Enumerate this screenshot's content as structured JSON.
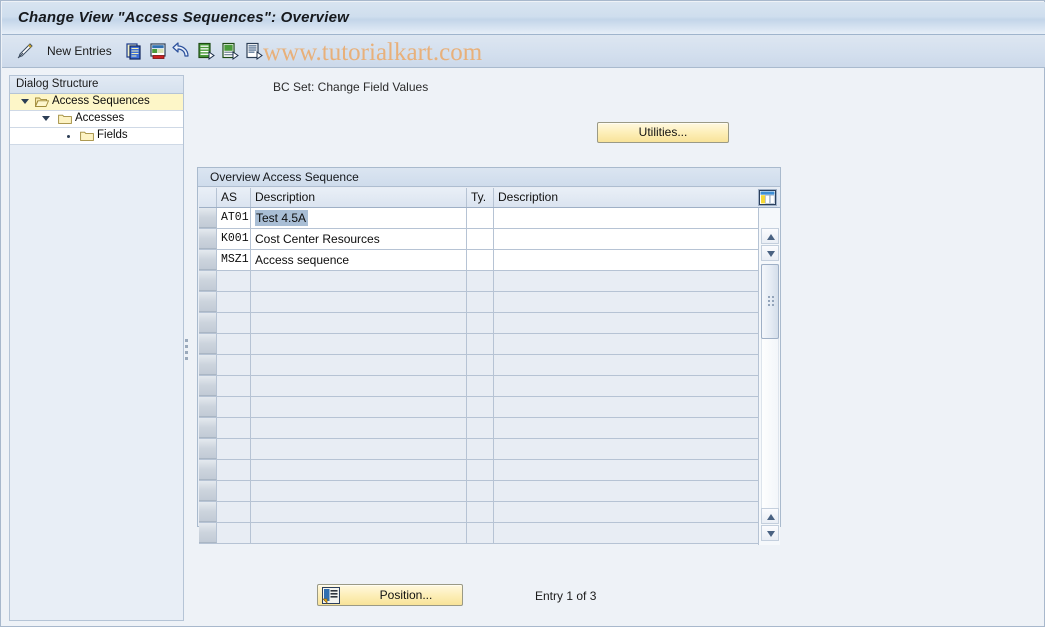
{
  "window": {
    "title": "Change View \"Access Sequences\": Overview"
  },
  "watermark": {
    "text": "www.tutorialkart.com"
  },
  "toolbar": {
    "new_entries_label": "New Entries",
    "bcset_label": "BC Set: Change Field Values",
    "icons": [
      {
        "name": "edit-pencil-icon"
      },
      {
        "name": "copy-icon"
      },
      {
        "name": "delete-icon"
      },
      {
        "name": "undo-icon"
      },
      {
        "name": "select-all-icon"
      },
      {
        "name": "deselect-all-icon"
      },
      {
        "name": "details-icon"
      }
    ]
  },
  "sidebar": {
    "header": "Dialog Structure",
    "items": [
      {
        "label": "Access Sequences",
        "icon": "open-folder-icon",
        "selected": true,
        "indent": 0,
        "toggle": "arrow"
      },
      {
        "label": "Accesses",
        "icon": "folder-icon",
        "selected": false,
        "indent": 1,
        "toggle": "arrow"
      },
      {
        "label": "Fields",
        "icon": "folder-icon",
        "selected": false,
        "indent": 2,
        "toggle": "dot"
      }
    ]
  },
  "buttons": {
    "utilities": "Utilities...",
    "position": "Position..."
  },
  "status": {
    "entry": "Entry 1 of 3"
  },
  "table": {
    "title": "Overview Access Sequence",
    "columns": [
      "AS",
      "Description",
      "Ty.",
      "Description"
    ],
    "column_config_icon": "column-config-icon",
    "rows": [
      {
        "as": "AT01",
        "description": "Test 4.5A",
        "ty": "",
        "description2": "",
        "selected": true
      },
      {
        "as": "K001",
        "description": "Cost Center Resources",
        "ty": "",
        "description2": "",
        "selected": false
      },
      {
        "as": "MSZ1",
        "description": "Access sequence",
        "ty": "",
        "description2": "",
        "selected": false
      }
    ],
    "empty_row_count": 13
  },
  "colors": {
    "accent": "#f8e399",
    "selection": "#a9bed5",
    "tree_selected": "#fdf6c8",
    "watermark": "#e8b07a"
  }
}
